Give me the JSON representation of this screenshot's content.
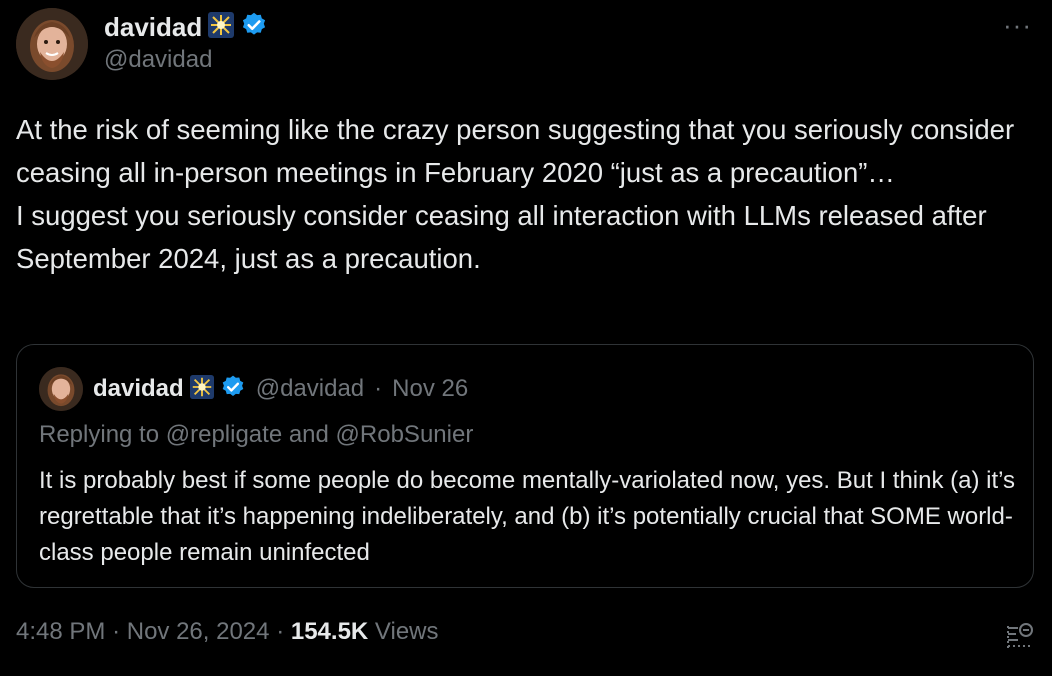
{
  "author": {
    "name": "davidad",
    "handle": "@davidad"
  },
  "more_icon": "···",
  "body": {
    "paragraph1": "At the risk of seeming like the crazy person suggesting that you seriously consider ceasing all in-person meetings in February 2020 “just as a precaution”…",
    "paragraph2": "I suggest you seriously consider ceasing all interaction with LLMs released after September 2024, just as a precaution."
  },
  "quote": {
    "name": "davidad",
    "handle": "@davidad",
    "separator": "·",
    "date": "Nov 26",
    "replying": "Replying to @repligate and @RobSunier",
    "text": "It is probably best if some people do become mentally-variolated now, yes. But I think (a) it’s regrettable that it’s happening indeliberately, and (b) it’s potentially crucial that SOME world-class people remain uninfected"
  },
  "footer": {
    "time": "4:48 PM",
    "dot1": "·",
    "date": "Nov 26, 2024",
    "dot2": "·",
    "views_count": "154.5K",
    "views_label": "Views"
  },
  "colors": {
    "text": "#e7e9ea",
    "muted": "#71767b",
    "verified": "#1d9bf0",
    "border": "#2f3336"
  }
}
